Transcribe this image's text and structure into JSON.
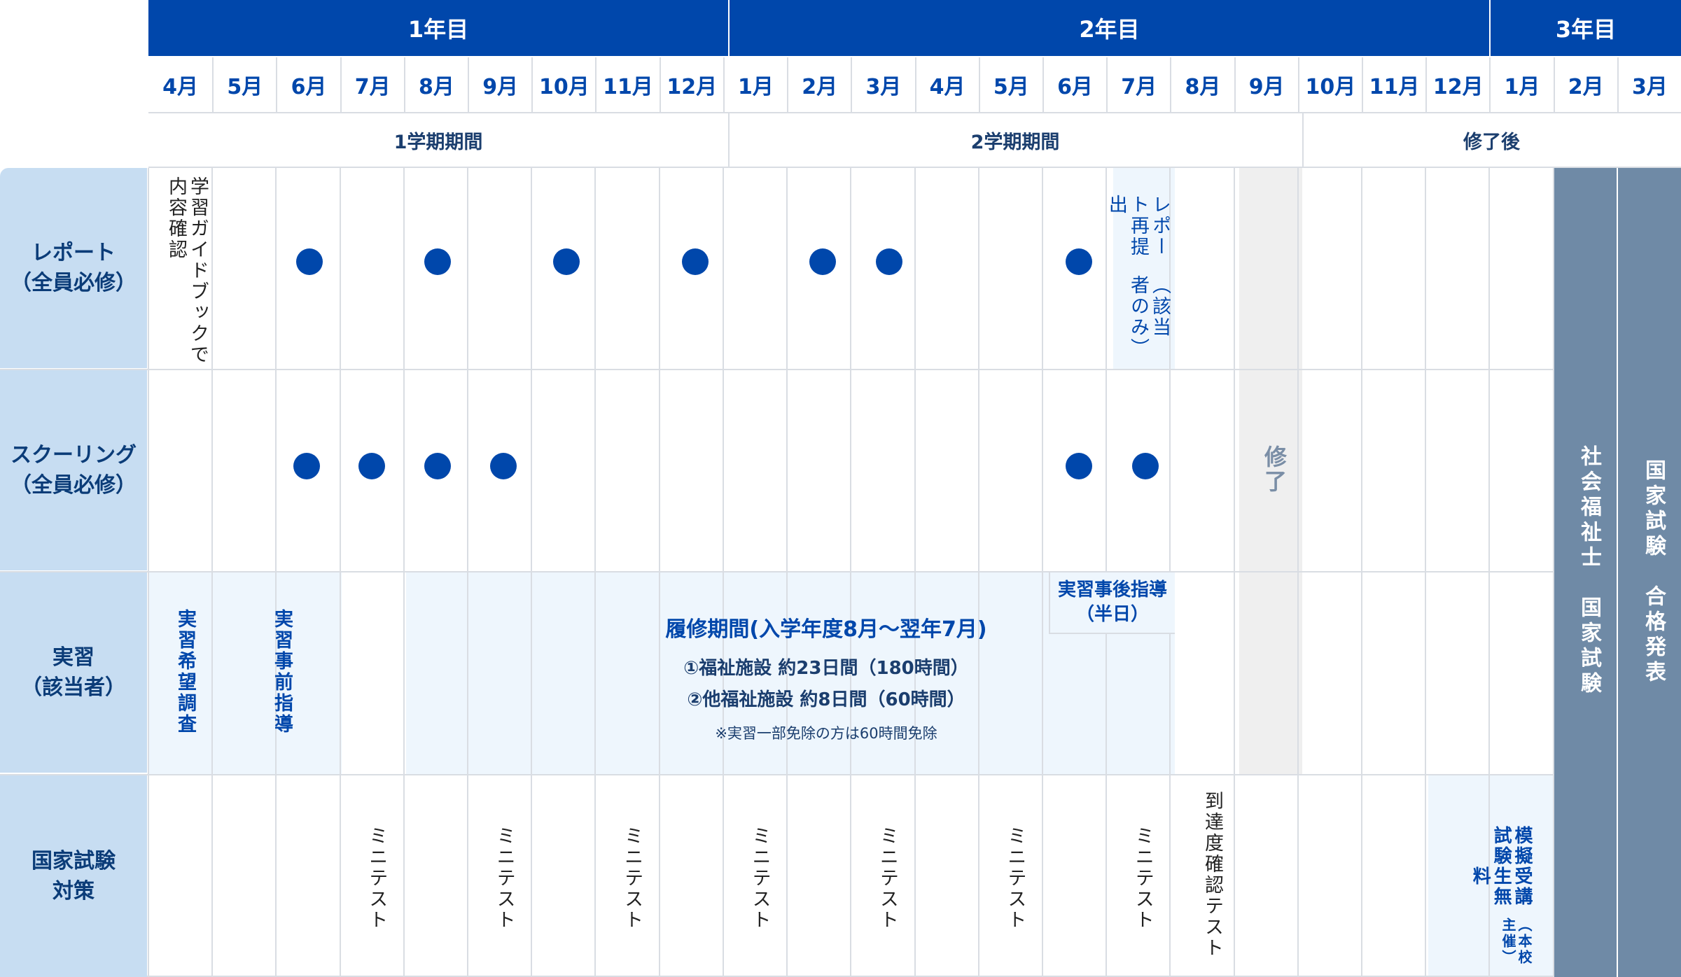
{
  "years": [
    "1年目",
    "2年目",
    "3年目"
  ],
  "months": [
    "4月",
    "5月",
    "6月",
    "7月",
    "8月",
    "9月",
    "10月",
    "11月",
    "12月",
    "1月",
    "2月",
    "3月",
    "4月",
    "5月",
    "6月",
    "7月",
    "8月",
    "9月",
    "10月",
    "11月",
    "12月",
    "1月",
    "2月",
    "3月"
  ],
  "terms": [
    "1学期期間",
    "2学期期間",
    "修了後"
  ],
  "rows": {
    "report": {
      "line1": "レポート",
      "line2": "（全員必修）"
    },
    "schooling": {
      "line1": "スクーリング",
      "line2": "（全員必修）"
    },
    "practicum": {
      "line1": "実習",
      "line2": "（該当者）"
    },
    "exam_prep": {
      "line1": "国家試験",
      "line2": "対策"
    }
  },
  "report_row": {
    "guide_note": "学習ガイドブックで内容確認",
    "resubmit": "レポート再提出",
    "resubmit_note": "（該当者のみ）"
  },
  "practicum_row": {
    "survey": "実習希望調査",
    "pre_guidance": "実習事前指導",
    "post_guidance": "実習事後指導",
    "post_guidance_note": "（半日）",
    "period_title": "履修期間(入学年度8月〜翌年7月)",
    "item1": "①福祉施設 約23日間（180時間）",
    "item2": "②他福祉施設 約8日間（60時間）",
    "note": "※実習一部免除の方は60時間免除"
  },
  "exam_row": {
    "mini_test": "ミニテスト",
    "achievement_test": "到達度確認テスト",
    "mock_exam": "模擬試験",
    "mock_exam_sub": "受講生無料",
    "mock_exam_note": "（本校主催）"
  },
  "completion": "修了",
  "national_exam": "社会福祉士　国家試験",
  "results": "国家試験　合格発表",
  "colors": {
    "primary": "#0047AB",
    "header_bg": "#c7ddf2",
    "light_bg": "#eef6fd",
    "gray_bg": "#efefef",
    "slate": "#6f8aa6"
  }
}
